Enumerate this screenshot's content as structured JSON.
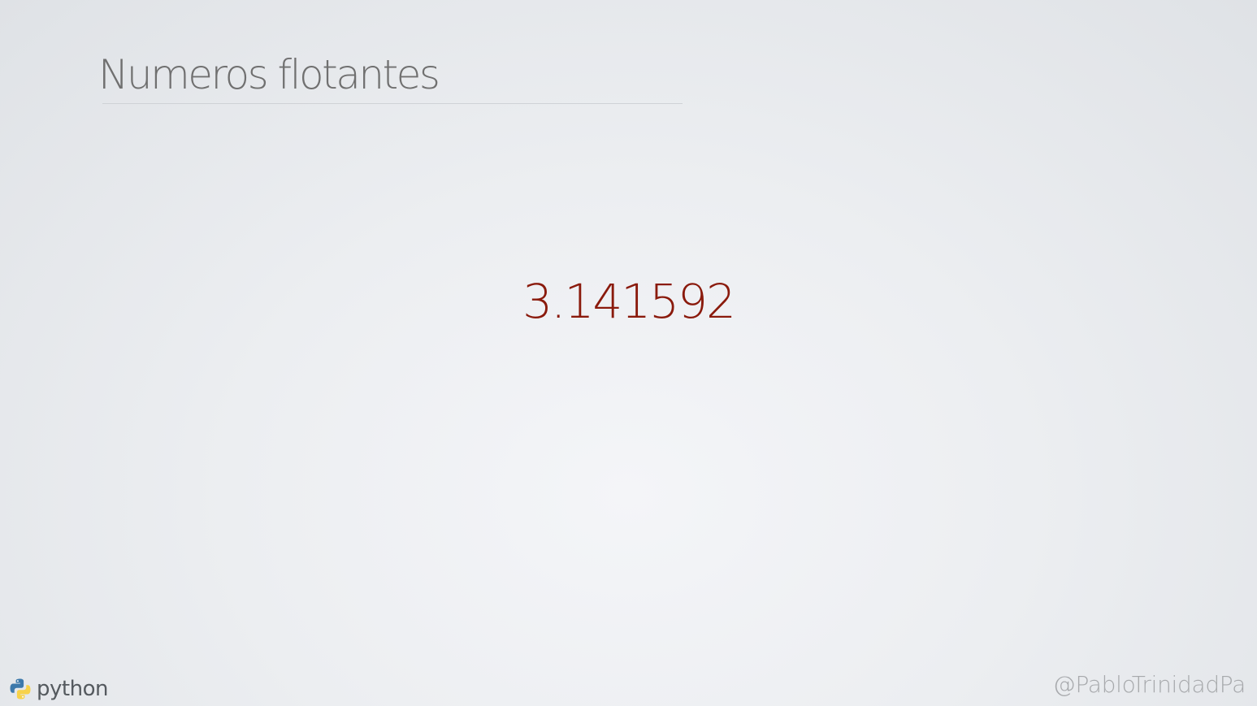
{
  "slide": {
    "title": "Numeros flotantes",
    "value": "3.141592"
  },
  "footer": {
    "logo_icon": "python-logo-icon",
    "logo_text": "python",
    "author_handle": "@PabloTrinidadPa"
  },
  "colors": {
    "title": "#707070",
    "value": "#8a1a0c",
    "author_handle": "#a7a9ac",
    "python_blue": "#3d79ab",
    "python_yellow": "#f7d24a"
  }
}
